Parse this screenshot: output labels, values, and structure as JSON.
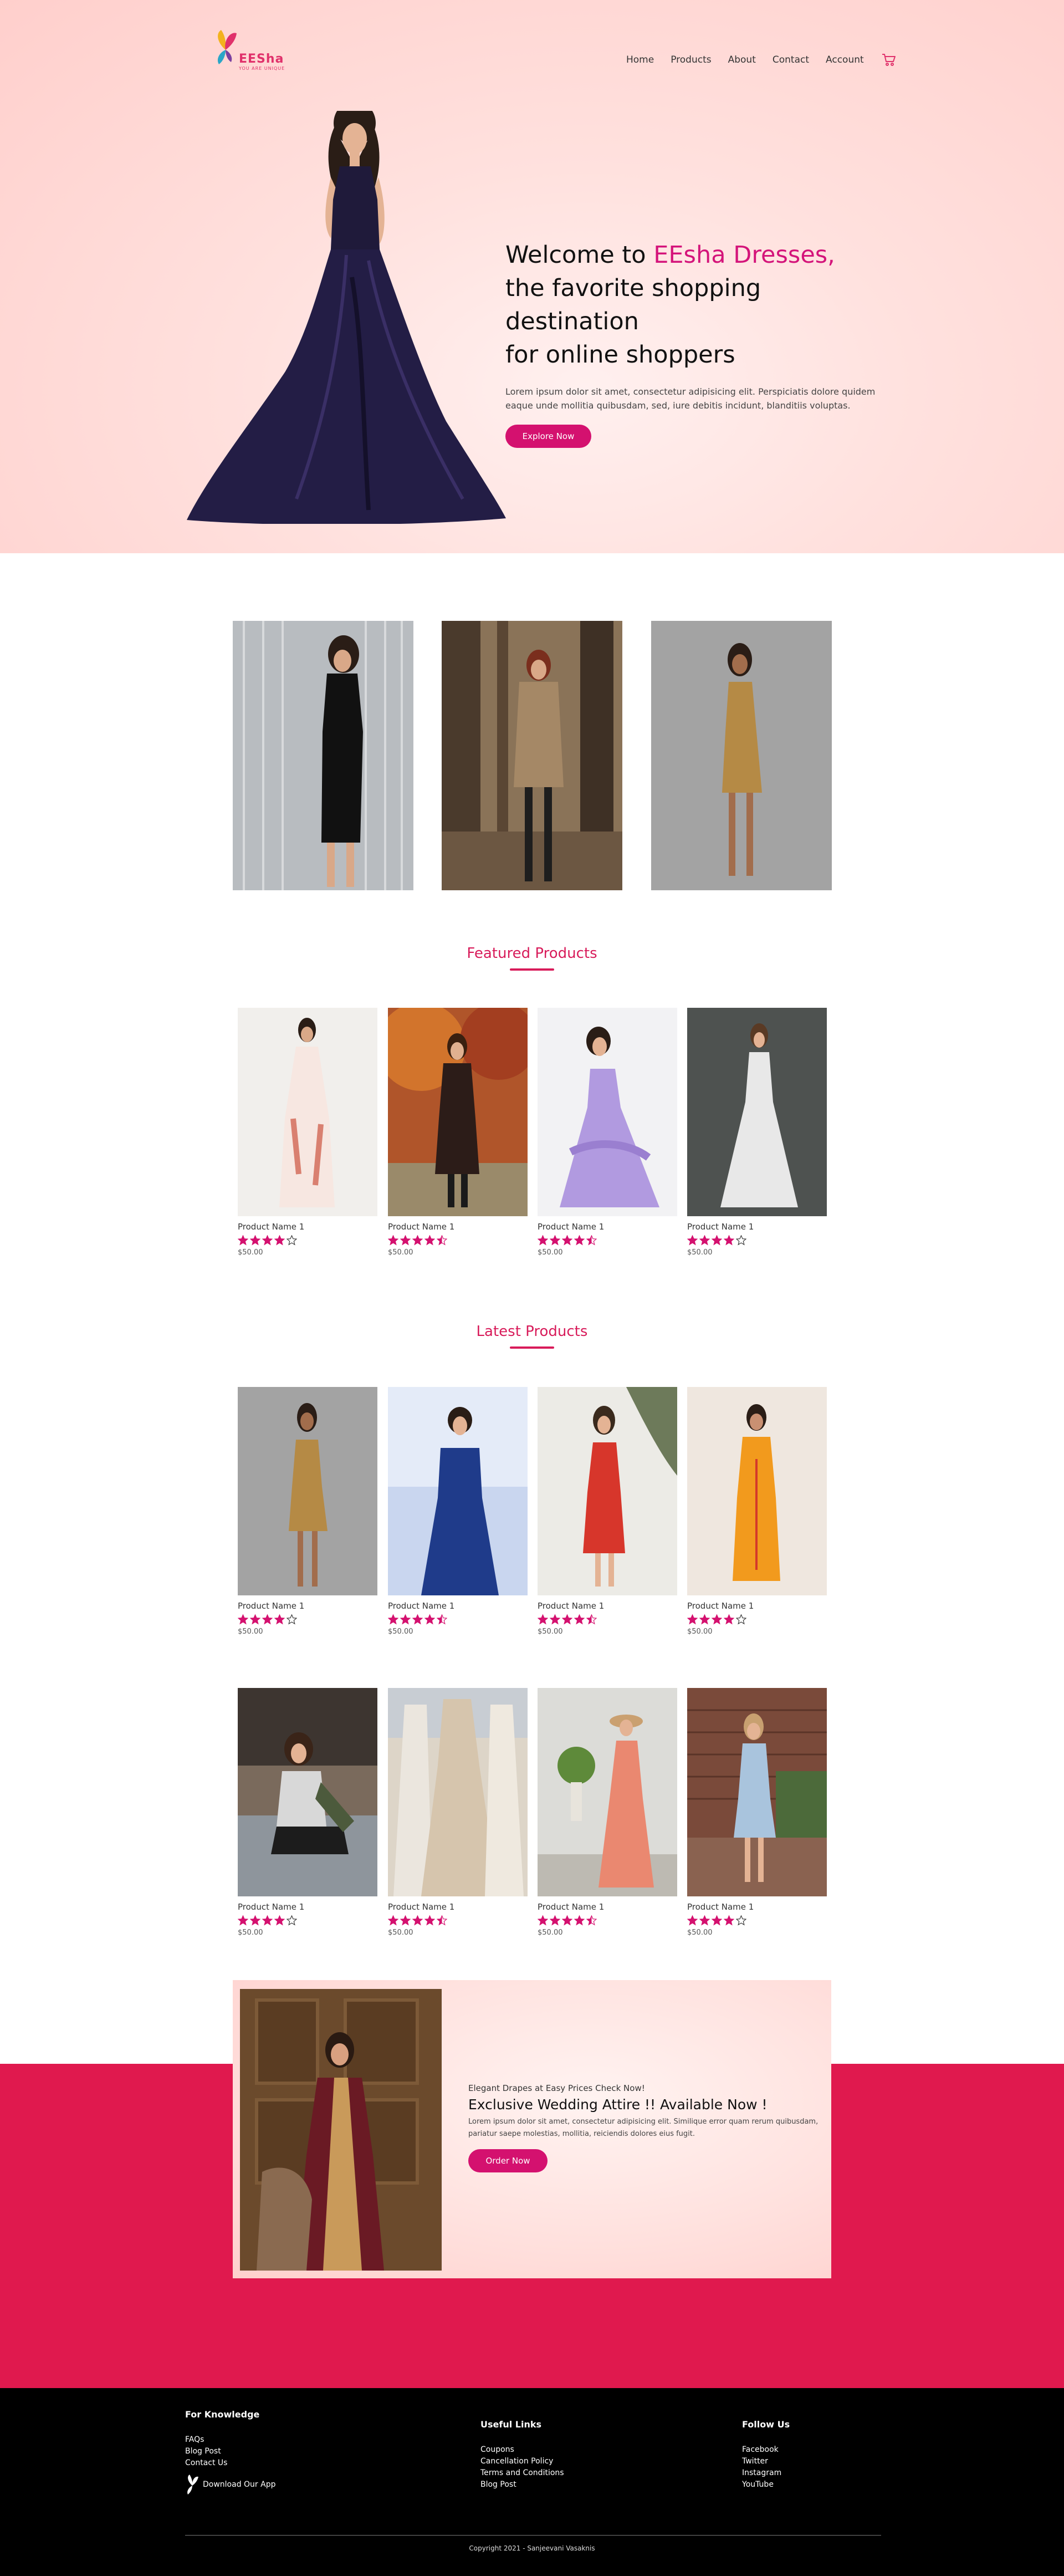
{
  "brand": {
    "name": "EESha",
    "tagline": "YOU ARE UNIQUE",
    "accent": "#d4147a"
  },
  "nav": {
    "items": [
      {
        "label": "Home"
      },
      {
        "label": "Products"
      },
      {
        "label": "About"
      },
      {
        "label": "Contact"
      },
      {
        "label": "Account"
      }
    ],
    "cart_icon": "cart-icon"
  },
  "hero": {
    "title_prefix": "Welcome to ",
    "title_accent": "EEsha Dresses,",
    "title_line2": "the favorite shopping destination",
    "title_line3": "for online shoppers",
    "description": "Lorem ipsum dolor sit amet, consectetur adipisicing elit. Perspiciatis dolore quidem eaque unde mollitia quibusdam, sed, iure debitis incidunt, blanditiis voluptas.",
    "button_label": "Explore Now"
  },
  "featured": {
    "title": "Featured Products",
    "products": [
      {
        "name": "Product Name 1",
        "rating": 4,
        "price": "$50.00"
      },
      {
        "name": "Product Name 1",
        "rating": 4.5,
        "price": "$50.00"
      },
      {
        "name": "Product Name 1",
        "rating": 4.5,
        "price": "$50.00"
      },
      {
        "name": "Product Name 1",
        "rating": 4,
        "price": "$50.00"
      }
    ]
  },
  "latest": {
    "title": "Latest Products",
    "products": [
      {
        "name": "Product Name 1",
        "rating": 4,
        "price": "$50.00"
      },
      {
        "name": "Product Name 1",
        "rating": 4.5,
        "price": "$50.00"
      },
      {
        "name": "Product Name 1",
        "rating": 4.5,
        "price": "$50.00"
      },
      {
        "name": "Product Name 1",
        "rating": 4,
        "price": "$50.00"
      },
      {
        "name": "Product Name 1",
        "rating": 4,
        "price": "$50.00"
      },
      {
        "name": "Product Name 1",
        "rating": 4.5,
        "price": "$50.00"
      },
      {
        "name": "Product Name 1",
        "rating": 4.5,
        "price": "$50.00"
      },
      {
        "name": "Product Name 1",
        "rating": 4,
        "price": "$50.00"
      }
    ]
  },
  "promo": {
    "small": "Elegant Drapes at Easy Prices Check Now!",
    "title": "Exclusive Wedding Attire !! Available Now !",
    "description": "Lorem ipsum dolor sit amet, consectetur adipisicing elit. Similique error quam rerum quibusdam, pariatur saepe molestias, mollitia, reiciendis dolores eius fugit.",
    "button_label": "Order Now"
  },
  "footer": {
    "knowledge": {
      "title": "For Knowledge",
      "links": [
        "FAQs",
        "Blog Post",
        "Contact Us"
      ],
      "app_label": "Download Our App"
    },
    "useful": {
      "title": "Useful Links",
      "links": [
        "Coupons",
        "Cancellation Policy",
        "Terms and Conditions",
        "Blog Post"
      ]
    },
    "follow": {
      "title": "Follow Us",
      "links": [
        "Facebook",
        "Twitter",
        "Instagram",
        "YouTube"
      ]
    },
    "copyright": "Copyright 2021 - Sanjeevani Vasaknis"
  },
  "colors": {
    "star": "#d4116f",
    "red_band": "#e0194e",
    "section_title": "#d81b5a"
  }
}
